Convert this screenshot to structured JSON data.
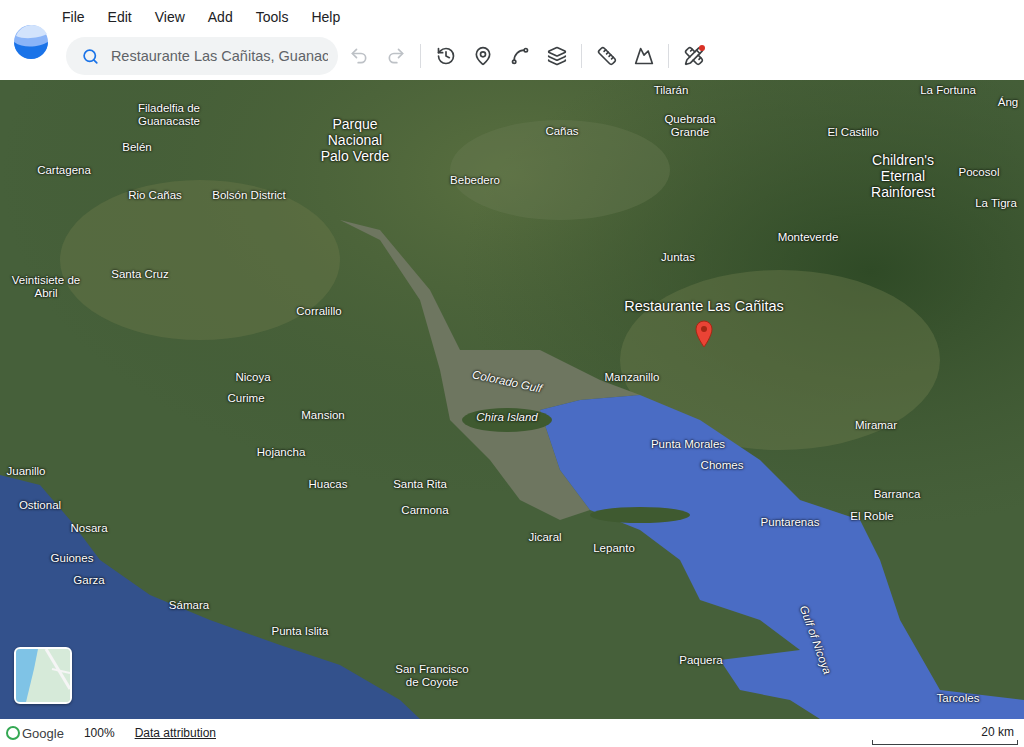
{
  "menu": [
    "File",
    "Edit",
    "View",
    "Add",
    "Tools",
    "Help"
  ],
  "search": {
    "value": "Restaurante Las Cañitas, Guanac"
  },
  "toolbar_groups": [
    [
      {
        "kind": "undo",
        "disabled": true,
        "badge": false
      },
      {
        "kind": "redo",
        "disabled": true,
        "badge": false
      }
    ],
    [
      {
        "kind": "history",
        "disabled": false,
        "badge": false
      },
      {
        "kind": "placemark",
        "disabled": false,
        "badge": false
      },
      {
        "kind": "path",
        "disabled": false,
        "badge": false
      },
      {
        "kind": "layers",
        "disabled": false,
        "badge": false
      }
    ],
    [
      {
        "kind": "measure",
        "disabled": false,
        "badge": false
      },
      {
        "kind": "terrain",
        "disabled": false,
        "badge": false
      }
    ],
    [
      {
        "kind": "tools",
        "disabled": false,
        "badge": true
      }
    ]
  ],
  "map": {
    "pin": {
      "label": "Restaurante Las Cañitas"
    },
    "labels": [
      {
        "text": "Filadelfia de Guanacaste",
        "kind": "place"
      },
      {
        "text": "Parque Nacional Palo Verde",
        "kind": "area"
      },
      {
        "text": "Tilarán",
        "kind": "place"
      },
      {
        "text": "Quebrada Grande",
        "kind": "place"
      },
      {
        "text": "La Fortuna",
        "kind": "place"
      },
      {
        "text": "Áng",
        "kind": "place"
      },
      {
        "text": "Cañas",
        "kind": "place"
      },
      {
        "text": "El Castillo",
        "kind": "place"
      },
      {
        "text": "Children's Eternal Rainforest",
        "kind": "area"
      },
      {
        "text": "Belén",
        "kind": "place"
      },
      {
        "text": "Cartagena",
        "kind": "place"
      },
      {
        "text": "Pocosol",
        "kind": "place"
      },
      {
        "text": "Bebedero",
        "kind": "place"
      },
      {
        "text": "Rio Cañas",
        "kind": "place"
      },
      {
        "text": "Bolsón District",
        "kind": "place"
      },
      {
        "text": "La Tigra",
        "kind": "place"
      },
      {
        "text": "Monteverde",
        "kind": "place"
      },
      {
        "text": "Juntas",
        "kind": "place"
      },
      {
        "text": "Veintisiete de Abril",
        "kind": "place"
      },
      {
        "text": "Santa Cruz",
        "kind": "place"
      },
      {
        "text": "Corralillo",
        "kind": "place"
      },
      {
        "text": "Colorado Gulf",
        "kind": "water"
      },
      {
        "text": "Manzanillo",
        "kind": "place"
      },
      {
        "text": "Nicoya",
        "kind": "place"
      },
      {
        "text": "Chira Island",
        "kind": "water"
      },
      {
        "text": "Curime",
        "kind": "place"
      },
      {
        "text": "Mansion",
        "kind": "place"
      },
      {
        "text": "Miramar",
        "kind": "place"
      },
      {
        "text": "Punta Morales",
        "kind": "place"
      },
      {
        "text": "Hojancha",
        "kind": "place"
      },
      {
        "text": "Chomes",
        "kind": "place"
      },
      {
        "text": "Juanillo",
        "kind": "place"
      },
      {
        "text": "Huacas",
        "kind": "place"
      },
      {
        "text": "Santa Rita",
        "kind": "place"
      },
      {
        "text": "Barranca",
        "kind": "place"
      },
      {
        "text": "Ostional",
        "kind": "place"
      },
      {
        "text": "Carmona",
        "kind": "place"
      },
      {
        "text": "Puntarenas",
        "kind": "place"
      },
      {
        "text": "El Roble",
        "kind": "place"
      },
      {
        "text": "Nosara",
        "kind": "place"
      },
      {
        "text": "Jicaral",
        "kind": "place"
      },
      {
        "text": "Lepanto",
        "kind": "place"
      },
      {
        "text": "Guiones",
        "kind": "place"
      },
      {
        "text": "Garza",
        "kind": "place"
      },
      {
        "text": "Sámara",
        "kind": "place"
      },
      {
        "text": "Gulf of Nicoya",
        "kind": "water"
      },
      {
        "text": "Punta Islita",
        "kind": "place"
      },
      {
        "text": "Paquera",
        "kind": "place"
      },
      {
        "text": "San Francisco de Coyote",
        "kind": "place"
      },
      {
        "text": "Tarcoles",
        "kind": "place"
      }
    ]
  },
  "status_bar": {
    "brand": "Google",
    "zoom": "100%",
    "attribution": "Data attribution",
    "scale": "20 km"
  }
}
